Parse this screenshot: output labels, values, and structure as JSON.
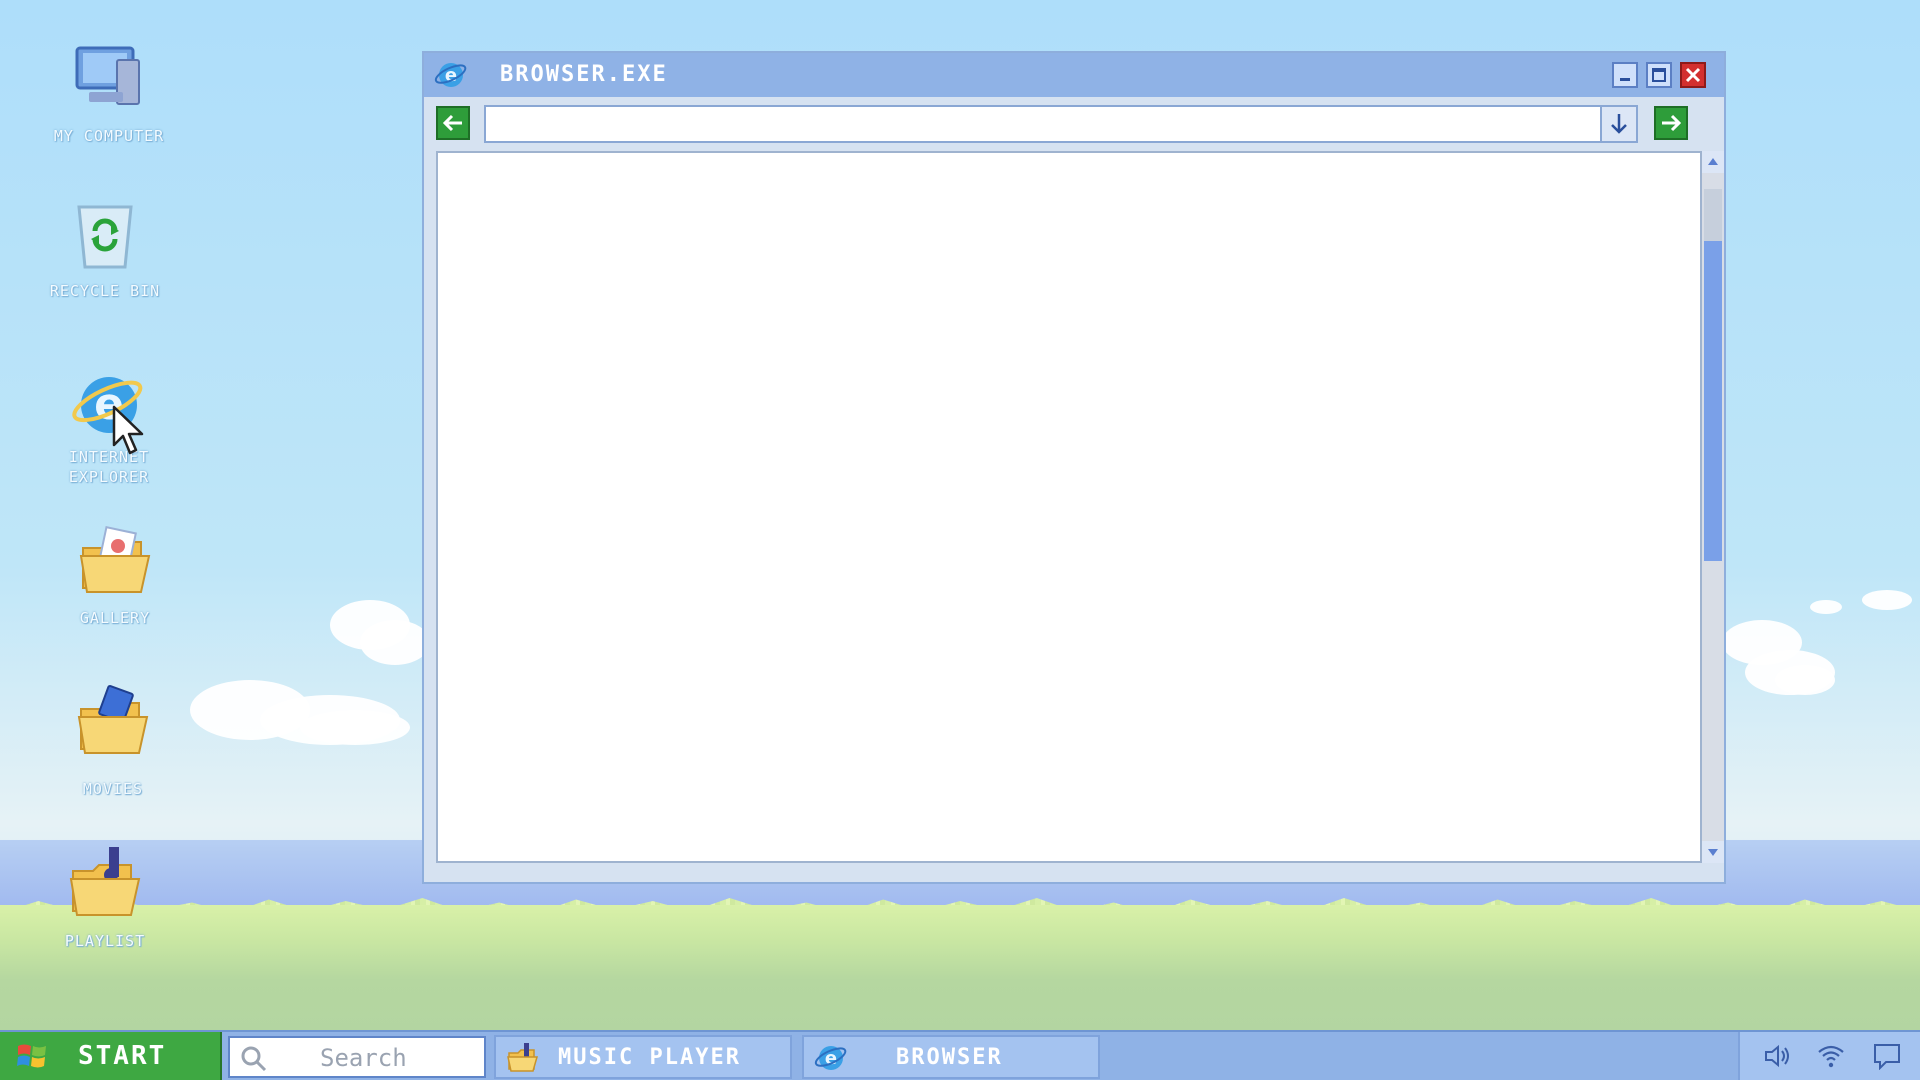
{
  "desktop": {
    "icons": [
      {
        "label": "MY COMPUTER",
        "icon": "my-computer-icon"
      },
      {
        "label": "RECYCLE BIN",
        "icon": "recycle-bin-icon"
      },
      {
        "label": "INTERNET\nEXPLORER",
        "label_line1": "INTERNET",
        "label_line2": "EXPLORER",
        "icon": "internet-explorer-icon"
      },
      {
        "label": "GALLERY",
        "icon": "gallery-folder-icon"
      },
      {
        "label": "MOVIES",
        "icon": "movies-folder-icon"
      },
      {
        "label": "PLAYLIST",
        "icon": "playlist-folder-icon"
      }
    ]
  },
  "window": {
    "title": "BROWSER.EXE",
    "app_icon": "browser-icon",
    "controls": {
      "minimize": "minimize-icon",
      "maximize": "maximize-icon",
      "close": "close-icon"
    },
    "toolbar": {
      "back_icon": "arrow-left-icon",
      "forward_icon": "arrow-right-icon",
      "dropdown_icon": "arrow-down-icon",
      "address_value": "",
      "address_placeholder": ""
    }
  },
  "taskbar": {
    "start_label": "START",
    "search_placeholder": "Search",
    "items": [
      {
        "label": "MUSIC PLAYER",
        "icon": "music-folder-icon"
      },
      {
        "label": "BROWSER",
        "icon": "browser-icon"
      }
    ],
    "tray": [
      "volume-icon",
      "wifi-icon",
      "notification-icon"
    ]
  },
  "colors": {
    "sky": "#aedefa",
    "title_bar": "#8fb2e6",
    "start_green": "#3ea842",
    "close_red": "#d32f2f",
    "nav_green": "#2e9d3a",
    "scroll_thumb": "#7aa0e8"
  }
}
